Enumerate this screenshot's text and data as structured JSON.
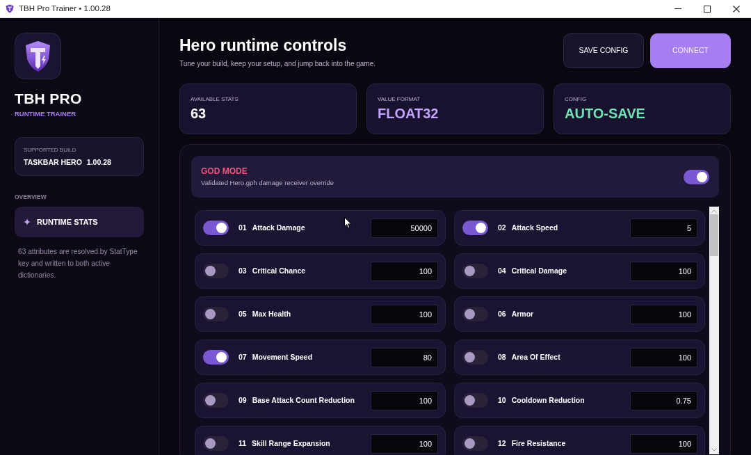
{
  "window": {
    "title": "TBH Pro Trainer • 1.00.28"
  },
  "sidebar": {
    "brand": "TBH PRO",
    "tagline": "RUNTIME TRAINER",
    "build": {
      "label": "SUPPORTED BUILD",
      "product": "TASKBAR HERO",
      "version": "1.00.28"
    },
    "section": "OVERVIEW",
    "nav": [
      {
        "label": "RUNTIME STATS",
        "selected": true
      }
    ],
    "note": "63 attributes are resolved by StatType key and written to both active dictionaries."
  },
  "header": {
    "title": "Hero runtime controls",
    "subtitle": "Tune your build, keep your setup, and jump back into the game.",
    "buttons": [
      {
        "label": "SAVE CONFIG",
        "kind": "secondary"
      },
      {
        "label": "CONNECT",
        "kind": "primary"
      }
    ]
  },
  "summary": [
    {
      "label": "AVAILABLE STATS",
      "value": "63",
      "color": "#ffffff"
    },
    {
      "label": "VALUE FORMAT",
      "value": "FLOAT32",
      "color": "#c3a4ff"
    },
    {
      "label": "CONFIG",
      "value": "AUTO-SAVE",
      "color": "#6fe3b4"
    }
  ],
  "god_mode": {
    "title": "GOD MODE",
    "description": "Validated Hero.gph damage receiver override",
    "on": true
  },
  "stats": [
    {
      "number": "01",
      "name": "Attack Damage",
      "on": true,
      "value": "50000"
    },
    {
      "number": "02",
      "name": "Attack Speed",
      "on": true,
      "value": "5"
    },
    {
      "number": "03",
      "name": "Critical Chance",
      "on": false,
      "value": "100"
    },
    {
      "number": "04",
      "name": "Critical Damage",
      "on": false,
      "value": "100"
    },
    {
      "number": "05",
      "name": "Max Health",
      "on": false,
      "value": "100"
    },
    {
      "number": "06",
      "name": "Armor",
      "on": false,
      "value": "100"
    },
    {
      "number": "07",
      "name": "Movement Speed",
      "on": true,
      "value": "80"
    },
    {
      "number": "08",
      "name": "Area Of Effect",
      "on": false,
      "value": "100"
    },
    {
      "number": "09",
      "name": "Base Attack Count Reduction",
      "on": false,
      "value": "100"
    },
    {
      "number": "10",
      "name": "Cooldown Reduction",
      "on": false,
      "value": "0.75"
    },
    {
      "number": "11",
      "name": "Skill Range Expansion",
      "on": false,
      "value": "100"
    },
    {
      "number": "12",
      "name": "Fire Resistance",
      "on": false,
      "value": "100"
    }
  ]
}
